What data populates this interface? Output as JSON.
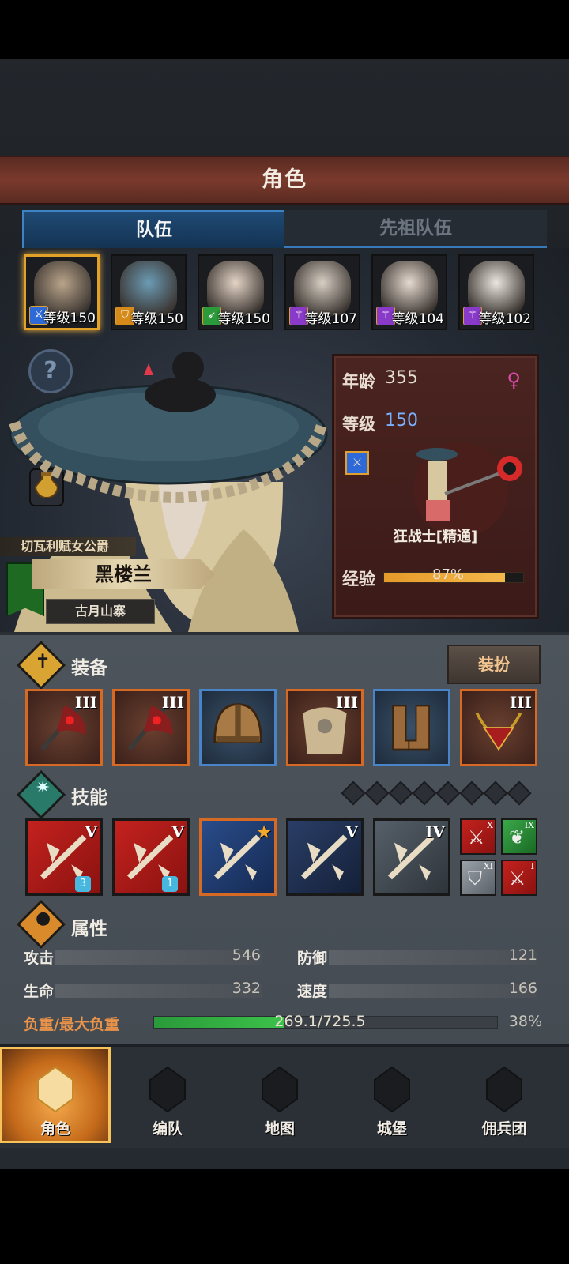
{
  "header": {
    "title": "角色"
  },
  "tabs": [
    {
      "label": "队伍"
    },
    {
      "label": "先祖队伍"
    }
  ],
  "team": [
    {
      "level_text": "等级150",
      "class_icon": "sword-icon",
      "class_color": "#2d6ad8",
      "face_color": "#b9a48a"
    },
    {
      "level_text": "等级150",
      "class_icon": "shield-icon",
      "class_color": "#d68a1a",
      "face_color": "#6b9bb4"
    },
    {
      "level_text": "等级150",
      "class_icon": "bow-icon",
      "class_color": "#2a9a3a",
      "face_color": "#e4d4c6"
    },
    {
      "level_text": "等级107",
      "class_icon": "staff-icon",
      "class_color": "#8a3ac8",
      "face_color": "#d8cfc4"
    },
    {
      "level_text": "等级104",
      "class_icon": "staff-icon",
      "class_color": "#8a3ac8",
      "face_color": "#e6dad0"
    },
    {
      "level_text": "等级102",
      "class_icon": "staff-icon",
      "class_color": "#8a3ac8",
      "face_color": "#ece6e0"
    }
  ],
  "hero": {
    "title": "切瓦利赋女公爵",
    "name": "黑楼兰",
    "place": "古月山寨"
  },
  "info": {
    "age_label": "年龄",
    "age": "355",
    "level_label": "等级",
    "level": "150",
    "class_name": "狂战士[精通]",
    "exp_label": "经验",
    "exp_text": "87%",
    "exp_fraction": 0.87,
    "gender_icon": "female-icon"
  },
  "equipment": {
    "title": "装备",
    "dress_button": "装扮",
    "items": [
      {
        "icon": "axe-icon",
        "tier": "III",
        "rarity": "orange"
      },
      {
        "icon": "axe-icon",
        "tier": "III",
        "rarity": "orange"
      },
      {
        "icon": "helmet-icon",
        "tier": "",
        "rarity": "blue"
      },
      {
        "icon": "fur-armor-icon",
        "tier": "III",
        "rarity": "orange"
      },
      {
        "icon": "boots-icon",
        "tier": "",
        "rarity": "blue"
      },
      {
        "icon": "amulet-icon",
        "tier": "III",
        "rarity": "orange"
      }
    ]
  },
  "skills": {
    "title": "技能",
    "slots_total": 8,
    "items": [
      {
        "icon": "cleave-icon",
        "tier": "V",
        "gem": "3",
        "style": "red"
      },
      {
        "icon": "slash-icon",
        "tier": "V",
        "gem": "1",
        "style": "red"
      },
      {
        "icon": "claw-icon",
        "tier": "★",
        "gem": "",
        "style": "blue"
      },
      {
        "icon": "crystal-sword-icon",
        "tier": "V",
        "gem": "",
        "style": "dark"
      },
      {
        "icon": "crystal-arm-icon",
        "tier": "IV",
        "gem": "",
        "style": "gray"
      }
    ],
    "mini": [
      {
        "icon": "sword-icon",
        "tier": "X",
        "style": "red"
      },
      {
        "icon": "wing-icon",
        "tier": "IX",
        "style": "green"
      },
      {
        "icon": "shield-icon",
        "tier": "XI",
        "style": "gray"
      },
      {
        "icon": "sword-icon",
        "tier": "I",
        "style": "red"
      }
    ]
  },
  "attributes": {
    "title": "属性",
    "stats": [
      {
        "label": "攻击",
        "value": "546"
      },
      {
        "label": "防御",
        "value": "121"
      },
      {
        "label": "生命",
        "value": "332"
      },
      {
        "label": "速度",
        "value": "166"
      }
    ],
    "weight_label": "负重/最大负重",
    "weight_text": "269.1/725.5",
    "weight_percent": "38%",
    "weight_fraction": 0.38
  },
  "nav": [
    {
      "label": "角色",
      "icon": "knight-icon",
      "active": true
    },
    {
      "label": "编队",
      "icon": "squad-icon",
      "active": false
    },
    {
      "label": "地图",
      "icon": "compass-map-icon",
      "active": false
    },
    {
      "label": "城堡",
      "icon": "castle-icon",
      "active": false
    },
    {
      "label": "佣兵团",
      "icon": "mercenary-icon",
      "active": false
    }
  ]
}
